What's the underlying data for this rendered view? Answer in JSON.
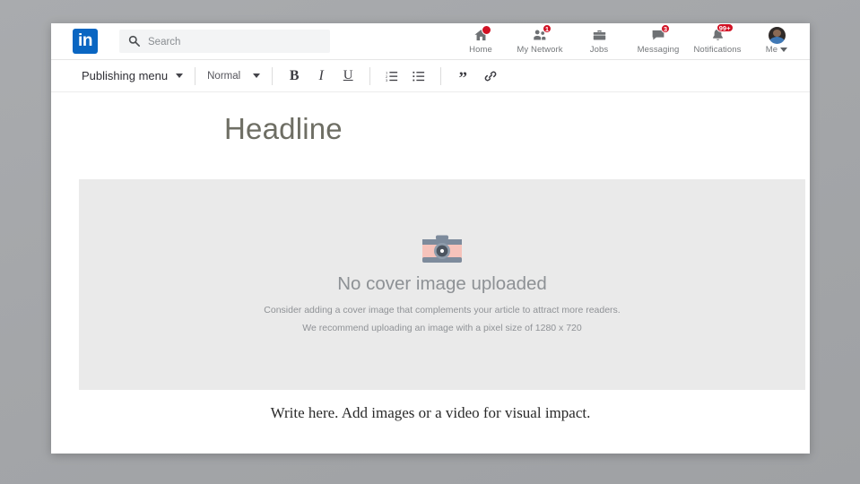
{
  "app": {
    "name": "LinkedIn",
    "logo_text": "in",
    "brand_color": "#0a66c2",
    "badge_color": "#d11124"
  },
  "search": {
    "placeholder": "Search",
    "value": "",
    "icon": "search-icon"
  },
  "nav": {
    "items": [
      {
        "label": "Home",
        "icon": "home-icon",
        "badge": "",
        "badge_type": "dot"
      },
      {
        "label": "My Network",
        "icon": "my-network-icon",
        "badge": "1",
        "badge_type": "count"
      },
      {
        "label": "Jobs",
        "icon": "jobs-icon",
        "badge": "",
        "badge_type": "none"
      },
      {
        "label": "Messaging",
        "icon": "messaging-icon",
        "badge": "3",
        "badge_type": "count"
      },
      {
        "label": "Notifications",
        "icon": "notifications-icon",
        "badge": "99+",
        "badge_type": "count"
      },
      {
        "label": "Me",
        "icon": "avatar",
        "badge": "",
        "badge_type": "none"
      }
    ]
  },
  "toolbar": {
    "publishing_menu_label": "Publishing menu",
    "paragraph_style_label": "Normal",
    "bold_label": "B",
    "italic_label": "I",
    "underline_label": "U",
    "quote_label": "”",
    "buttons": [
      {
        "name": "bold-button",
        "icon": "bold-icon"
      },
      {
        "name": "italic-button",
        "icon": "italic-icon"
      },
      {
        "name": "underline-button",
        "icon": "underline-icon"
      },
      {
        "name": "ordered-list-button",
        "icon": "ordered-list-icon"
      },
      {
        "name": "unordered-list-button",
        "icon": "unordered-list-icon"
      },
      {
        "name": "quote-button",
        "icon": "quote-icon"
      },
      {
        "name": "link-button",
        "icon": "link-icon"
      }
    ]
  },
  "article": {
    "headline_placeholder": "Headline",
    "cover": {
      "icon": "camera-icon",
      "title": "No cover image uploaded",
      "hint_line_1": "Consider adding a cover image that complements your article to attract more readers.",
      "hint_line_2": "We recommend uploading an image with a pixel size of 1280 x 720"
    },
    "body_placeholder": "Write here. Add images or a video for visual impact."
  }
}
